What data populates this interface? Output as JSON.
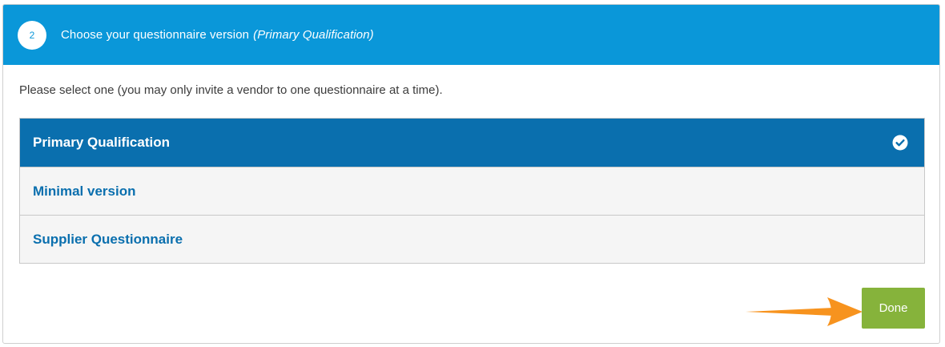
{
  "header": {
    "step_number": "2",
    "title": "Choose your questionnaire version",
    "subtitle": "(Primary Qualification)"
  },
  "instructions": "Please select one (you may only invite a vendor to one questionnaire at a time).",
  "options": [
    {
      "label": "Primary Qualification",
      "selected": true
    },
    {
      "label": "Minimal version",
      "selected": false
    },
    {
      "label": "Supplier Questionnaire",
      "selected": false
    }
  ],
  "done_label": "Done",
  "colors": {
    "header_bg": "#0a97d9",
    "selected_bg": "#0a6fae",
    "option_text": "#0a6fae",
    "option_bg": "#f5f5f5",
    "done_bg": "#86b33b",
    "arrow": "#f7931e"
  },
  "icons": {
    "selected_option": "check-circle-icon",
    "annotation": "arrow-right-icon"
  }
}
